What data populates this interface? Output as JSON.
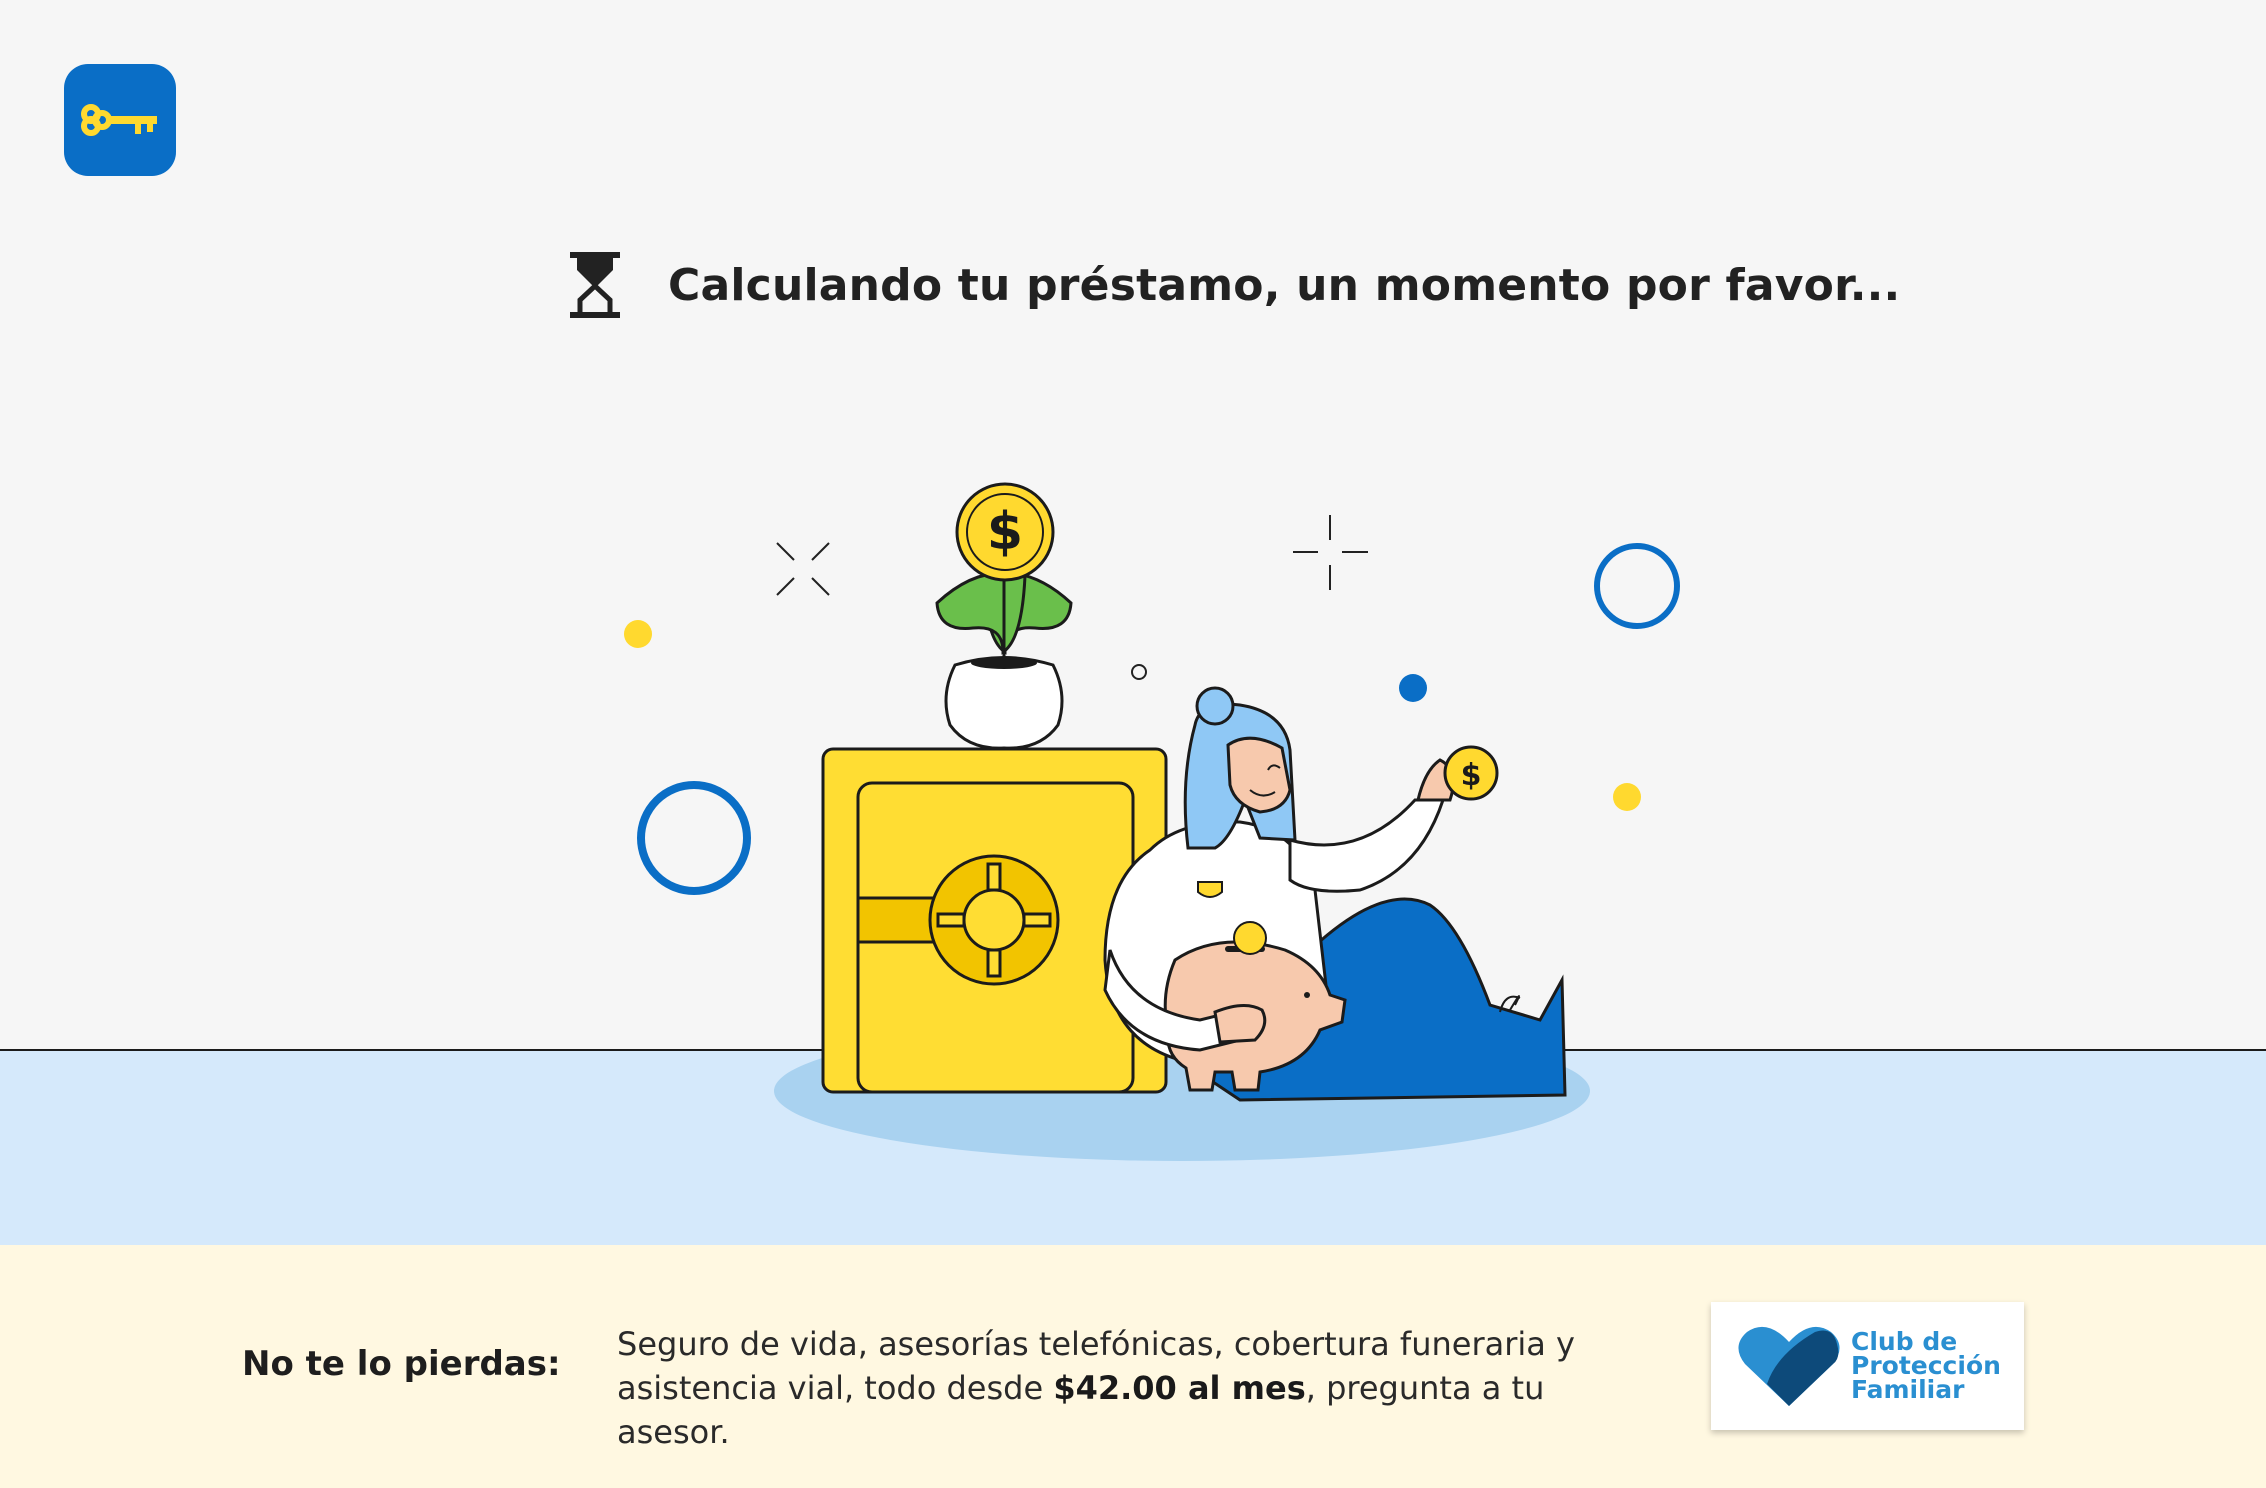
{
  "app": {
    "icon": "key-icon",
    "accent": "#0a6ec6",
    "icon_color": "#ffd92f"
  },
  "loading": {
    "icon": "hourglass-icon",
    "message": "Calculando tu préstamo, un momento por favor..."
  },
  "illustration": {
    "coin_symbol": "$",
    "hand_coin_symbol": "$"
  },
  "promo": {
    "label": "No te lo pierdas:",
    "text_before": "Seguro de vida, asesorías telefónicas, cobertura funeraria y asistencia vial, todo desde ",
    "price": "$42.00 al mes",
    "text_after": ", pregunta a tu asesor.",
    "background": "#fff8e1"
  },
  "badge": {
    "icon": "heart-icon",
    "line1": "Club de",
    "line2": "Protección",
    "line3": "Familiar",
    "color": "#2a8fd1"
  }
}
